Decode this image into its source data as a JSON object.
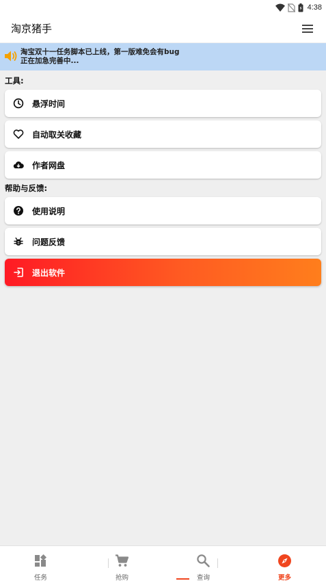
{
  "status_bar": {
    "time": "4:38",
    "icons": [
      "wifi-icon",
      "no-sim-icon",
      "battery-icon"
    ]
  },
  "app_bar": {
    "title": "淘京猪手",
    "menu_icon": "hamburger-menu-icon"
  },
  "notice": {
    "icon": "speaker-icon",
    "line1": "淘宝双十一任务脚本已上线，第一版难免会有bug",
    "line2": "正在加急完善中..."
  },
  "sections": {
    "tools_label": "工具:",
    "help_label": "帮助与反馈:"
  },
  "tools": [
    {
      "label": "悬浮时间",
      "icon": "clock-icon"
    },
    {
      "label": "自动取关收藏",
      "icon": "heart-icon"
    },
    {
      "label": "作者网盘",
      "icon": "cloud-download-icon"
    }
  ],
  "help": [
    {
      "label": "使用说明",
      "icon": "help-circle-icon"
    },
    {
      "label": "问题反馈",
      "icon": "bug-icon"
    }
  ],
  "exit": {
    "label": "退出软件",
    "icon": "exit-icon"
  },
  "bottom_nav": [
    {
      "label": "任务",
      "icon": "dashboard-icon",
      "active": false
    },
    {
      "label": "抢购",
      "icon": "shopping-cart-icon",
      "active": false
    },
    {
      "label": "查询",
      "icon": "search-icon",
      "active": false
    },
    {
      "label": "更多",
      "icon": "compass-icon",
      "active": true
    }
  ],
  "colors": {
    "accent": "#f0451e",
    "notice_bg": "#bcd7f5",
    "speaker": "#f4a100",
    "exit_gradient_start": "#ff1a24",
    "exit_gradient_end": "#ff7e1c"
  }
}
